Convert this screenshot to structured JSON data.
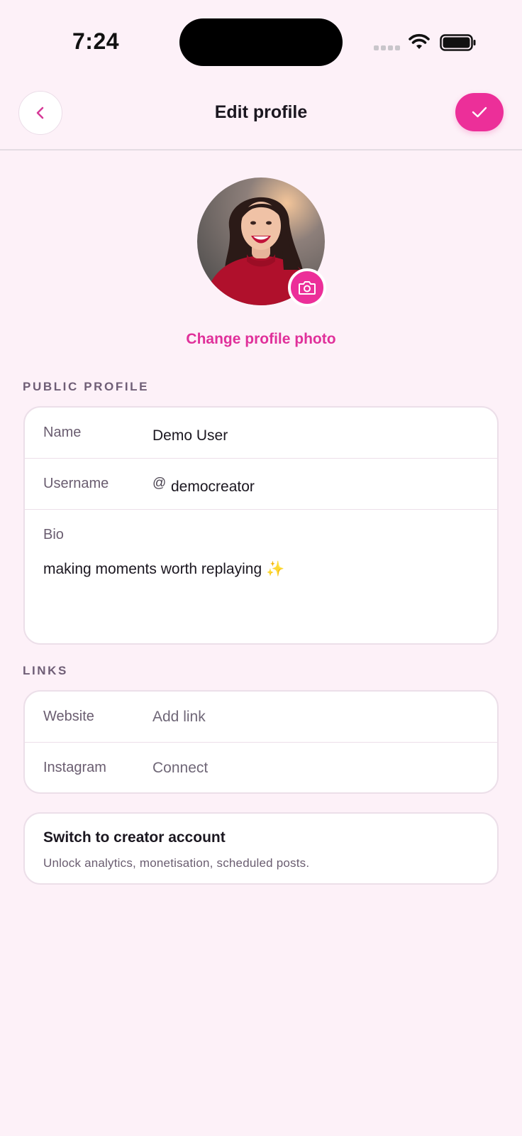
{
  "status_bar": {
    "time": "7:24"
  },
  "header": {
    "title": "Edit profile",
    "back_icon": "chevron-left-icon",
    "save_icon": "check-icon",
    "accent_color": "#ec2f99"
  },
  "profile_photo": {
    "change_label": "Change profile photo",
    "camera_icon": "camera-icon"
  },
  "public_profile": {
    "section_title": "PUBLIC PROFILE",
    "name_label": "Name",
    "name_value": "Demo User",
    "username_label": "Username",
    "username_prefix": "@",
    "username_value": "democreator",
    "bio_label": "Bio",
    "bio_value": "making moments worth replaying ✨"
  },
  "links": {
    "section_title": "LINKS",
    "website_label": "Website",
    "website_value": "Add link",
    "instagram_label": "Instagram",
    "instagram_value": "Connect"
  },
  "creator": {
    "title": "Switch to creator account",
    "subtitle": "Unlock analytics, monetisation, scheduled posts."
  }
}
